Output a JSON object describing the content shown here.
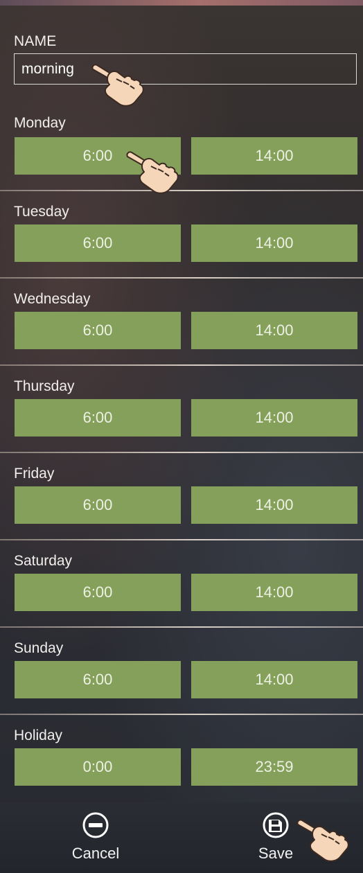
{
  "name_field": {
    "label": "NAME",
    "value": "morning"
  },
  "days": [
    {
      "label": "Monday",
      "start": "6:00",
      "end": "14:00"
    },
    {
      "label": "Tuesday",
      "start": "6:00",
      "end": "14:00"
    },
    {
      "label": "Wednesday",
      "start": "6:00",
      "end": "14:00"
    },
    {
      "label": "Thursday",
      "start": "6:00",
      "end": "14:00"
    },
    {
      "label": "Friday",
      "start": "6:00",
      "end": "14:00"
    },
    {
      "label": "Saturday",
      "start": "6:00",
      "end": "14:00"
    },
    {
      "label": "Sunday",
      "start": "6:00",
      "end": "14:00"
    },
    {
      "label": "Holiday",
      "start": "0:00",
      "end": "23:59"
    }
  ],
  "actions": {
    "cancel": {
      "label": "Cancel",
      "icon": "minus-circle-icon"
    },
    "save": {
      "label": "Save",
      "icon": "save-disk-icon"
    }
  },
  "colors": {
    "time_button": "#85a05a",
    "accent_strip": "#a56f6b"
  }
}
